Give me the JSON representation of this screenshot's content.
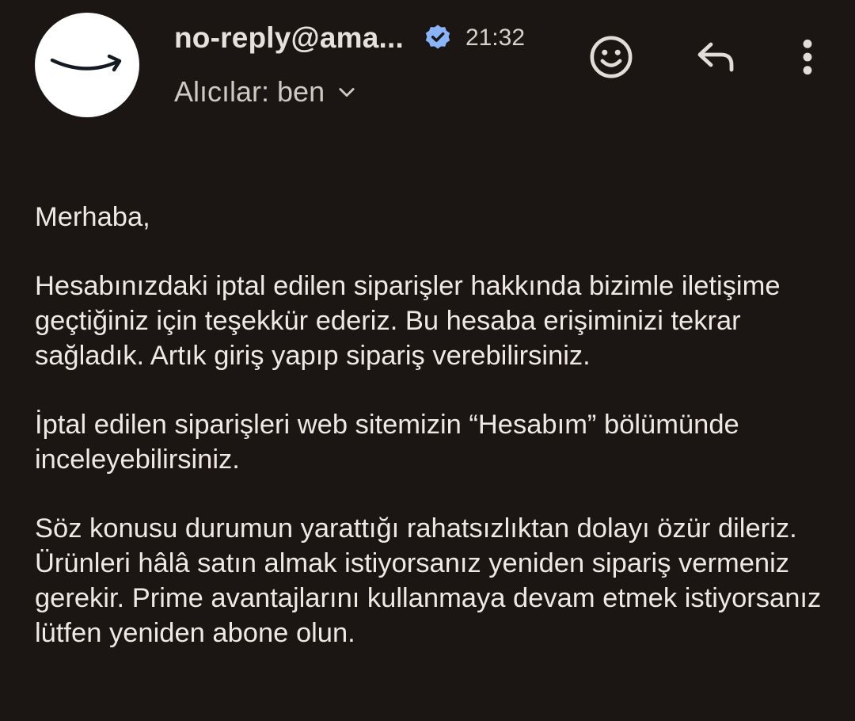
{
  "header": {
    "sender": "no-reply@ama...",
    "time": "21:32",
    "recipients_label": "Alıcılar: ben"
  },
  "icons": {
    "avatar": "amazon-smile-logo",
    "verified": "verified-badge-icon",
    "recipients_toggle": "chevron-down-icon",
    "emoji": "emoji-react-icon",
    "reply": "reply-arrow-icon",
    "more": "more-vertical-icon"
  },
  "colors": {
    "background": "#1b1614",
    "text": "#efe9e4",
    "muted_text": "#cfc9c4",
    "verified_badge": "#8ab4f8",
    "icon": "#e3ddd8",
    "logo_smile": "#131a22"
  },
  "message": {
    "greeting": "Merhaba,",
    "paragraphs": [
      "Hesabınızdaki iptal edilen siparişler hakkında bizimle iletişime geçtiğiniz için teşekkür ederiz. Bu hesaba erişiminizi tekrar sağladık. Artık giriş yapıp sipariş verebilirsiniz.",
      "İptal edilen siparişleri web sitemizin “Hesabım” bölümünde inceleyebilirsiniz.",
      "Söz konusu durumun yarattığı rahatsızlıktan dolayı özür dileriz. Ürünleri hâlâ satın almak istiyorsanız yeniden sipariş vermeniz gerekir. Prime avantajlarını kullanmaya devam etmek istiyorsanız lütfen yeniden abone olun."
    ]
  }
}
